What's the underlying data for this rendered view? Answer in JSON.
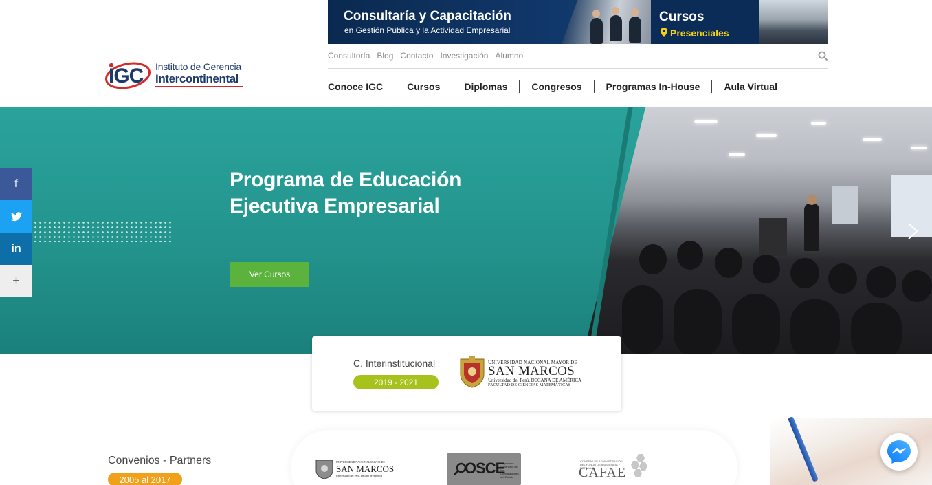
{
  "logo": {
    "mark_text": "IGC",
    "line1": "Instituto de Gerencia",
    "line2": "Intercontinental"
  },
  "banner": {
    "title": "Consultaría y Capacitación",
    "subtitle": "en Gestión Pública y la Actividad Empresarial",
    "cursos": "Cursos",
    "presenciales": "Presenciales",
    "colors": {
      "bg": "#0c2c58",
      "accent": "#f4d019"
    }
  },
  "subnav": {
    "items": [
      "Consultoría",
      "Blog",
      "Contacto",
      "Investigación",
      "Alumno"
    ],
    "search_icon": "search-icon"
  },
  "mainnav": {
    "items": [
      "Conoce IGC",
      "Cursos",
      "Diplomas",
      "Congresos",
      "Programas In-House",
      "Aula Virtual"
    ]
  },
  "hero": {
    "title": "Programa de Educación Ejecutiva Empresarial",
    "button": "Ver Cursos",
    "next_icon": "chevron-right-icon",
    "colors": {
      "bg": "#23948d",
      "button": "#5bb33d"
    }
  },
  "social": {
    "items": [
      {
        "icon": "facebook-icon",
        "glyph": "f"
      },
      {
        "icon": "twitter-icon",
        "glyph": "🐦"
      },
      {
        "icon": "linkedin-icon",
        "glyph": "in"
      },
      {
        "icon": "plus-icon",
        "glyph": "+"
      }
    ]
  },
  "agreement": {
    "label": "C. Interinstitucional",
    "period": "2019 - 2021",
    "university_top": "UNIVERSIDAD NACIONAL MAYOR DE",
    "university_name": "SAN MARCOS",
    "university_sub1": "Universidad del Perú, DECANA DE AMÉRICA",
    "university_sub2": "FACULTAD DE CIENCIAS MATEMÁTICAS",
    "badge_color": "#a7c11d"
  },
  "partners": {
    "label": "Convenios - Partners",
    "period": "2005 al 2017",
    "badge_color": "#f0a019",
    "um_top": "UNIVERSIDAD NACIONAL MAYOR DE",
    "um_name": "SAN MARCOS",
    "um_sub": "Universidad del Perú, Decana de América",
    "osce_name": "OSCE",
    "osce_small": "Organismo Supervisor de las Contrataciones del Estado",
    "cafae_small": "CONSEJO DE ADMINISTRACIÓN DEL FONDO DE ASISTENCIA Y ESTÍMULO",
    "cafae_name": "CAFAE"
  },
  "messenger": {
    "icon": "messenger-icon"
  }
}
